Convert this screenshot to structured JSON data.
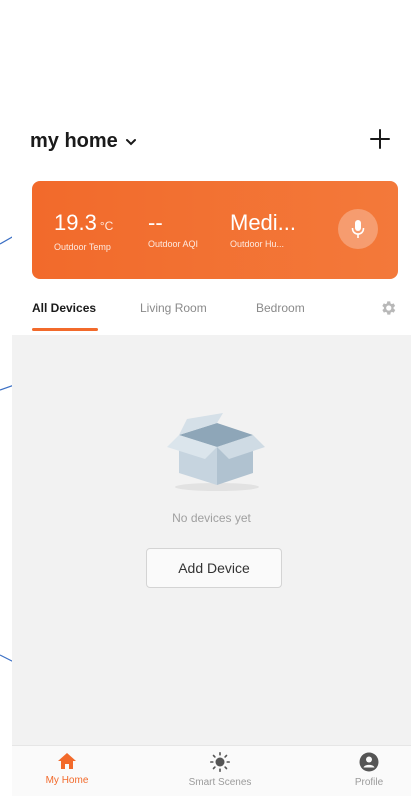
{
  "header": {
    "home_name": "my home"
  },
  "weather": {
    "temp_value": "19.3",
    "temp_unit": "°C",
    "temp_label": "Outdoor Temp",
    "aqi_value": "--",
    "aqi_label": "Outdoor AQI",
    "humidity_value": "Medi...",
    "humidity_label": "Outdoor Hu..."
  },
  "tabs": [
    {
      "label": "All Devices",
      "active": true
    },
    {
      "label": "Living Room",
      "active": false
    },
    {
      "label": "Bedroom",
      "active": false
    }
  ],
  "empty_state": {
    "message": "No devices yet",
    "button_label": "Add Device"
  },
  "bottom_nav": [
    {
      "label": "My Home",
      "icon": "home-icon",
      "active": true
    },
    {
      "label": "Smart Scenes",
      "icon": "sun-icon",
      "active": false
    },
    {
      "label": "Profile",
      "icon": "profile-icon",
      "active": false
    }
  ],
  "colors": {
    "accent": "#f26a2b",
    "annotation_line": "#3b6fc4"
  }
}
